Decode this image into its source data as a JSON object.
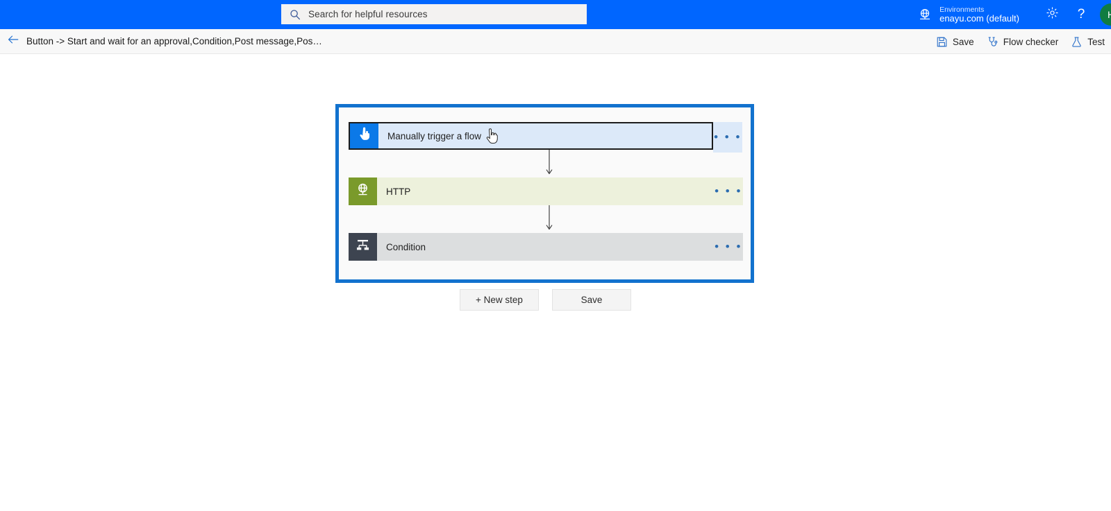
{
  "suite_bar": {
    "search": {
      "placeholder": "Search for helpful resources",
      "icon": "search-icon"
    },
    "environment": {
      "label": "Environments",
      "value": "enayu.com (default)",
      "icon": "environment-globe-icon"
    },
    "settings_icon": "gear-icon",
    "help_icon": "question-mark-icon",
    "help_label": "?",
    "avatar_initial": "H",
    "background_color": "#0066FF",
    "avatar_color": "#107C41"
  },
  "command_bar": {
    "back_icon": "back-arrow-icon",
    "breadcrumb": "Button -> Start and wait for an approval,Condition,Post message,Pos…",
    "buttons": [
      {
        "label": "Save",
        "icon": "save-floppy-icon"
      },
      {
        "label": "Flow checker",
        "icon": "stethoscope-icon"
      },
      {
        "label": "Test",
        "icon": "flask-icon"
      }
    ]
  },
  "designer": {
    "outline_color": "#1272CE",
    "cards": [
      {
        "title": "Manually trigger a flow",
        "icon": "hand-tap-icon",
        "icon_color": "#0B79E8",
        "body_color": "#DCE9F9",
        "selected": true,
        "menu": "• • •"
      },
      {
        "title": "HTTP",
        "icon": "globe-icon",
        "icon_color": "#7A9A2B",
        "body_color": "#EDF1DC",
        "selected": false,
        "menu": "• • •"
      },
      {
        "title": "Condition",
        "icon": "condition-branch-icon",
        "icon_color": "#3D4450",
        "body_color": "#DCDEDF",
        "selected": false,
        "menu": "• • •"
      }
    ],
    "cursor": "hand-pointer-cursor"
  },
  "bottom_actions": {
    "new_step_label": "+ New step",
    "save_label": "Save"
  }
}
